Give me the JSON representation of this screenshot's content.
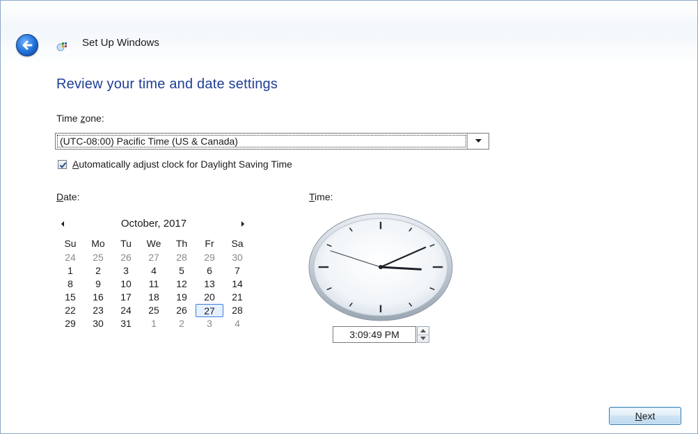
{
  "window": {
    "title": "Set Up Windows"
  },
  "page": {
    "heading": "Review your time and date settings"
  },
  "timezone": {
    "label_before": "Time ",
    "label_accel": "z",
    "label_after": "one:",
    "selected": "(UTC-08:00) Pacific Time (US & Canada)"
  },
  "dst": {
    "checked": true,
    "label_accel": "A",
    "label_rest": "utomatically adjust clock for Daylight Saving Time"
  },
  "date": {
    "label_accel": "D",
    "label_rest": "ate:"
  },
  "time": {
    "label_accel": "T",
    "label_rest": "ime:",
    "value": "3:09:49 PM",
    "hours": 3,
    "minutes": 9,
    "seconds": 49
  },
  "calendar": {
    "month_label": "October, 2017",
    "weekdays": [
      "Su",
      "Mo",
      "Tu",
      "We",
      "Th",
      "Fr",
      "Sa"
    ],
    "weeks": [
      [
        {
          "d": "24",
          "o": true
        },
        {
          "d": "25",
          "o": true
        },
        {
          "d": "26",
          "o": true
        },
        {
          "d": "27",
          "o": true
        },
        {
          "d": "28",
          "o": true
        },
        {
          "d": "29",
          "o": true
        },
        {
          "d": "30",
          "o": true
        }
      ],
      [
        {
          "d": "1"
        },
        {
          "d": "2"
        },
        {
          "d": "3"
        },
        {
          "d": "4"
        },
        {
          "d": "5"
        },
        {
          "d": "6"
        },
        {
          "d": "7"
        }
      ],
      [
        {
          "d": "8"
        },
        {
          "d": "9"
        },
        {
          "d": "10"
        },
        {
          "d": "11"
        },
        {
          "d": "12"
        },
        {
          "d": "13"
        },
        {
          "d": "14"
        }
      ],
      [
        {
          "d": "15"
        },
        {
          "d": "16"
        },
        {
          "d": "17"
        },
        {
          "d": "18"
        },
        {
          "d": "19"
        },
        {
          "d": "20"
        },
        {
          "d": "21"
        }
      ],
      [
        {
          "d": "22"
        },
        {
          "d": "23"
        },
        {
          "d": "24"
        },
        {
          "d": "25"
        },
        {
          "d": "26"
        },
        {
          "d": "27",
          "s": true
        },
        {
          "d": "28"
        }
      ],
      [
        {
          "d": "29"
        },
        {
          "d": "30"
        },
        {
          "d": "31"
        },
        {
          "d": "1",
          "o": true
        },
        {
          "d": "2",
          "o": true
        },
        {
          "d": "3",
          "o": true
        },
        {
          "d": "4",
          "o": true
        }
      ]
    ]
  },
  "buttons": {
    "next_accel": "N",
    "next_rest": "ext"
  },
  "icons": {
    "back": "back-arrow-icon",
    "app": "setup-windows-icon",
    "dropdown": "chevron-down-icon",
    "prev_month": "triangle-left-icon",
    "next_month": "triangle-right-icon",
    "spin_up": "triangle-up-icon",
    "spin_down": "triangle-down-icon"
  },
  "colors": {
    "heading": "#1e3e95",
    "accent": "#3a7bd5"
  }
}
